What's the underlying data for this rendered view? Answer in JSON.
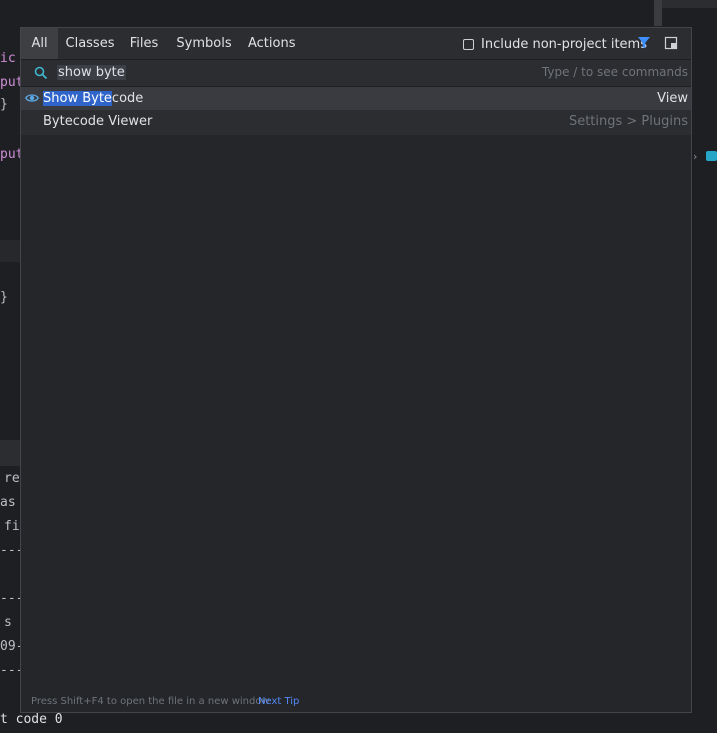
{
  "background": {
    "code_lines": [
      {
        "text": "ic",
        "kind": "kw"
      },
      {
        "text": "put",
        "kind": "kw"
      },
      {
        "text": "}",
        "kind": "plain"
      },
      {
        "text": "put",
        "kind": "kw"
      },
      {
        "text": "}",
        "kind": "plain"
      }
    ],
    "console_lines": [
      "re",
      "as",
      "fi",
      "---",
      "---",
      "s",
      "09-",
      "---"
    ],
    "bottom_text": "t code 0"
  },
  "popup": {
    "tabs": [
      {
        "label": "All",
        "active": true
      },
      {
        "label": "Classes",
        "active": false
      },
      {
        "label": "Files",
        "active": false
      },
      {
        "label": "Symbols",
        "active": false
      },
      {
        "label": "Actions",
        "active": false
      }
    ],
    "include_label": "Include non-project items",
    "include_checked": false,
    "search": {
      "value": "show byte",
      "hint": "Type / to see commands"
    },
    "results": [
      {
        "name_highlight": "Show Byte",
        "name_rest": "code",
        "right": "View",
        "icon": "eye-icon",
        "selected": true
      },
      {
        "name_highlight": "",
        "name_rest": "Bytecode Viewer",
        "right": "Settings > Plugins",
        "icon": "",
        "selected": false
      }
    ],
    "footer": {
      "tip": "Press Shift+F4 to open the file in a new window",
      "next_tip": "Next Tip"
    }
  },
  "colors": {
    "accent": "#2f65ca",
    "link": "#548af7",
    "filter_icon": "#3d8eff",
    "keyword": "#cf8ed6"
  }
}
